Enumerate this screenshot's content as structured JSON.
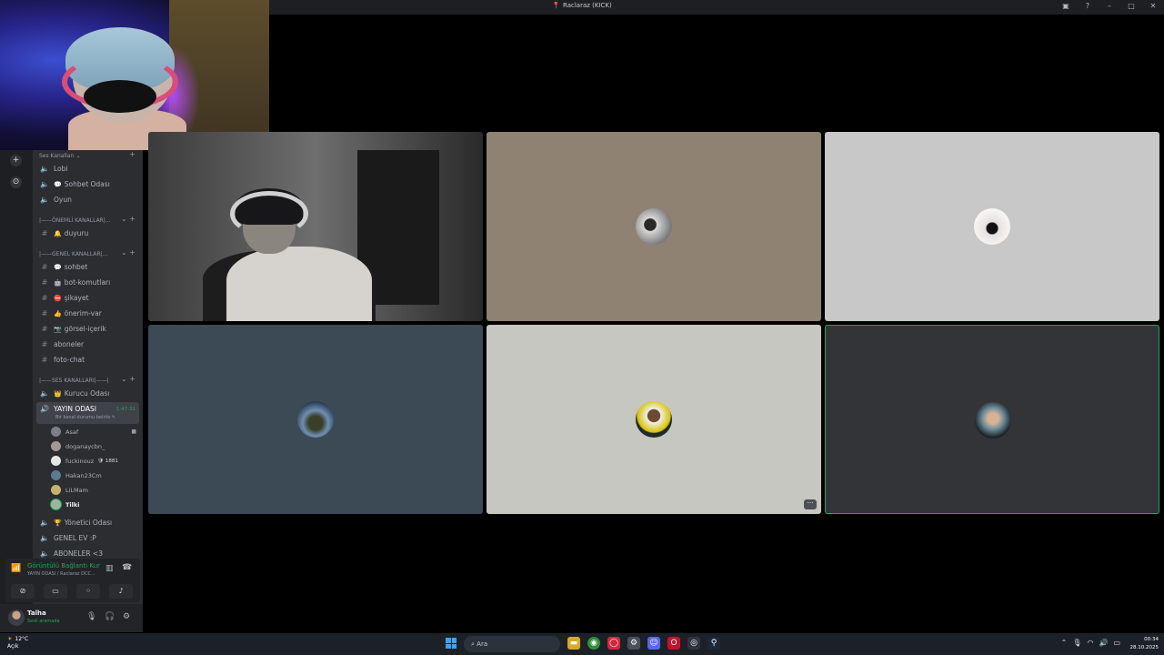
{
  "window": {
    "title": "Raclaraz (KICK)"
  },
  "sidebar": {
    "voice_header": "Ses Kanalları",
    "important_header": "|——ÖNEMLİ KANALLAR|...",
    "general_header": "|——GENEL KANALLAR|...",
    "ses_header": "|——SES KANALLARI|——|",
    "channels": [
      {
        "label": "Lobi",
        "emoji": ""
      },
      {
        "label": "Sohbet Odası",
        "emoji": "💬"
      },
      {
        "label": "Oyun",
        "emoji": ""
      },
      {
        "label": "duyuru",
        "emoji": "🔔"
      },
      {
        "label": "sohbet",
        "emoji": "💬"
      },
      {
        "label": "bot-komutları",
        "emoji": "🤖"
      },
      {
        "label": "şikayet",
        "emoji": "⛔"
      },
      {
        "label": "önerim-var",
        "emoji": "👍"
      },
      {
        "label": "görsel-içerik",
        "emoji": "📷"
      },
      {
        "label": "aboneler",
        "emoji": ""
      },
      {
        "label": "foto-chat",
        "emoji": ""
      },
      {
        "label": "Kurucu Odası",
        "emoji": "👑"
      },
      {
        "label": "YAYIN ODASI",
        "emoji": ""
      },
      {
        "label": "Yönetici Odası",
        "emoji": "🏆"
      },
      {
        "label": "GENEL EV :P",
        "emoji": ""
      },
      {
        "label": "ABONELER <3",
        "emoji": ""
      }
    ],
    "active_timer": "1:47:31",
    "active_subtext": "Bir kanal durumu belirle ✎",
    "members": [
      {
        "name": "Asaf",
        "extra": ""
      },
      {
        "name": "doganaycbn_",
        "extra": ""
      },
      {
        "name": "fuckinouz",
        "extra": "🛡 1881"
      },
      {
        "name": "Hakan23Cm",
        "extra": ""
      },
      {
        "name": "LiLMam",
        "extra": ""
      },
      {
        "name": "Tilki",
        "extra": ""
      }
    ]
  },
  "voice_panel": {
    "status": "Görüntülü Bağlantı Kur",
    "channel": "YAYIN ODASI / Raclaraz DCC..."
  },
  "user": {
    "name": "Talha",
    "status": "Sesli aramada"
  },
  "taskbar": {
    "temp": "12°C",
    "weather": "Açık",
    "search_placeholder": "Ara",
    "time": "00:34",
    "date": "28.10.2025"
  },
  "colors": {
    "accent": "#23a55a",
    "sidebar": "#2b2d31",
    "background": "#000000"
  }
}
